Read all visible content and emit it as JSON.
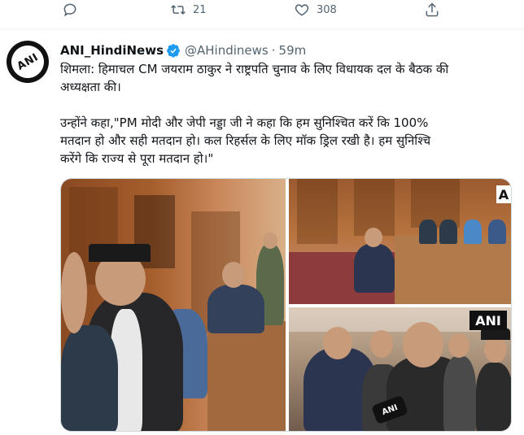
{
  "previous_tweet_actions": {
    "reply": {
      "icon": "reply-icon",
      "count": ""
    },
    "retweet": {
      "icon": "retweet-icon",
      "count": "21"
    },
    "like": {
      "icon": "like-icon",
      "count": "308"
    },
    "share": {
      "icon": "share-icon",
      "count": ""
    }
  },
  "tweet": {
    "avatar": {
      "label": "ANI"
    },
    "display_name": "ANI_HindiNews",
    "handle": "@AHindinews",
    "separator": "·",
    "timestamp": "59m",
    "text_line_1": "शिमला: हिमाचल CM जयराम ठाकुर ने राष्ट्रपति चुनाव के लिए विधायक दल के बैठक की",
    "text_line_2": "अध्यक्षता की।",
    "text_line_3": "उन्होंने कहा,\"PM मोदी और जेपी नड्डा जी ने कहा कि हम सुनिश्चित करें कि 100%",
    "text_line_4": "मतदान हो और सही मतदान हो। कल रिहर्सल के लिए मॉक ड्रिल रखी है। हम सुनिश्चि",
    "text_line_5": "करेंगे कि राज्य से पूरा मतदान हो।\"",
    "media": {
      "watermark_top": "A",
      "watermark_bottom": "ANI",
      "mic_label": "ANI"
    }
  },
  "colors": {
    "text_primary": "#0f1419",
    "text_secondary": "#536471",
    "verified": "#1d9bf0",
    "border": "#cfd9de"
  }
}
